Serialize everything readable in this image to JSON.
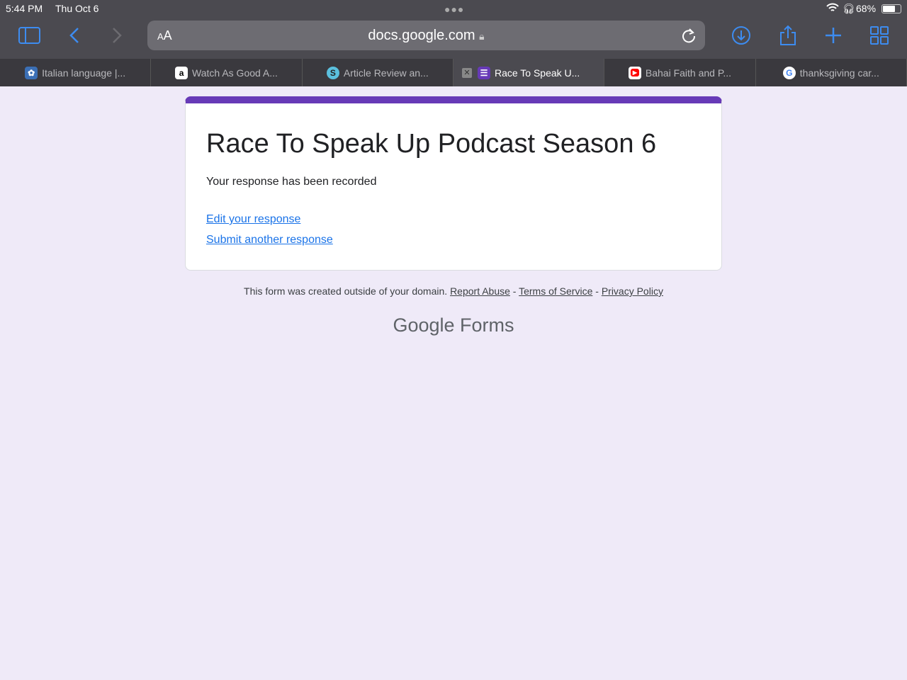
{
  "status": {
    "time": "5:44 PM",
    "date": "Thu Oct 6",
    "battery": "68%"
  },
  "browser": {
    "url": "docs.google.com",
    "aa_small": "A",
    "aa_large": "A"
  },
  "tabs": [
    {
      "label": "Italian language |...",
      "favicon": "globe-icon",
      "color": "#3b6fb5"
    },
    {
      "label": "Watch As Good A...",
      "favicon": "amazon-icon",
      "color": "#ffffff"
    },
    {
      "label": "Article Review an...",
      "favicon": "s-icon",
      "color": "#5bc0de"
    },
    {
      "label": "Race To Speak U...",
      "favicon": "forms-icon",
      "color": "#673ab7",
      "active": true
    },
    {
      "label": "Bahai Faith and P...",
      "favicon": "youtube-icon",
      "color": "#ff0000"
    },
    {
      "label": "thanksgiving car...",
      "favicon": "google-icon",
      "color": "#ffffff"
    }
  ],
  "form": {
    "title": "Race To Speak Up Podcast Season 6",
    "message": "Your response has been recorded",
    "edit_link": "Edit your response",
    "another_link": "Submit another response",
    "accent": "#673ab7"
  },
  "footer": {
    "notice": "This form was created outside of your domain.",
    "report": "Report Abuse",
    "sep": " - ",
    "terms": "Terms of Service",
    "privacy": "Privacy Policy",
    "logo_google": "Google",
    "logo_forms": "Forms"
  }
}
